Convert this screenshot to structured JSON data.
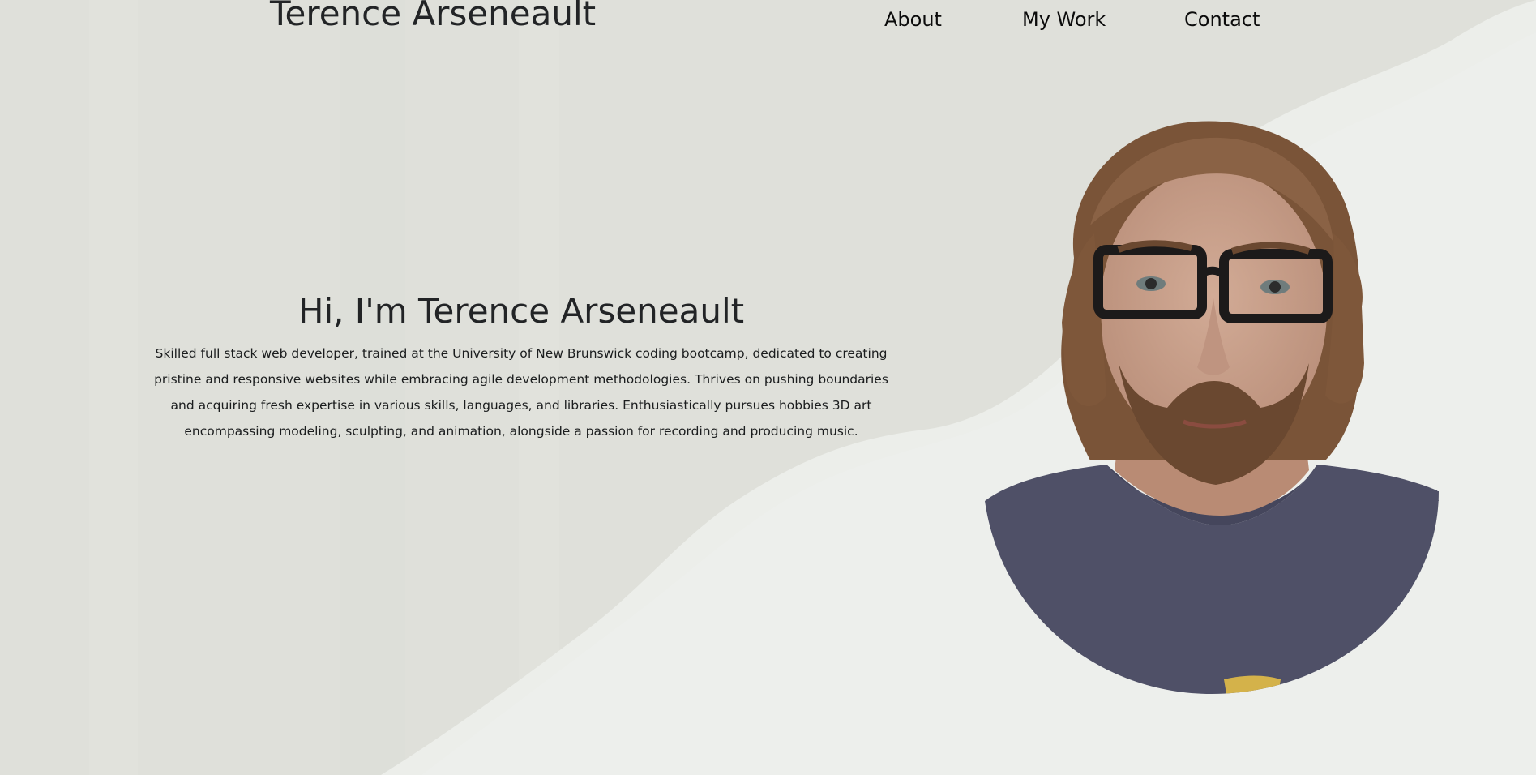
{
  "header": {
    "site_title": "Terence Arseneault",
    "nav": [
      {
        "label": "About"
      },
      {
        "label": "My Work"
      },
      {
        "label": "Contact"
      }
    ]
  },
  "hero": {
    "heading": "Hi, I'm Terence Arseneault",
    "bio": "Skilled full stack web developer, trained at the University of New Brunswick coding bootcamp, dedicated to creating pristine and responsive websites while embracing agile development methodologies. Thrives on pushing boundaries and acquiring fresh expertise in various skills, languages, and libraries. Enthusiastically pursues hobbies 3D art encompassing modeling, sculpting, and animation, alongside a passion for recording and producing music."
  },
  "colors": {
    "background_dark": "#dfe0da",
    "background_light": "#eceeea",
    "text": "#222426",
    "shirt": "#4f5067",
    "hair": "#7a5438",
    "skin": "#caa28d",
    "glasses": "#1c1a1a"
  },
  "images": {
    "portrait": "circular-cropped-headshot-photo"
  }
}
